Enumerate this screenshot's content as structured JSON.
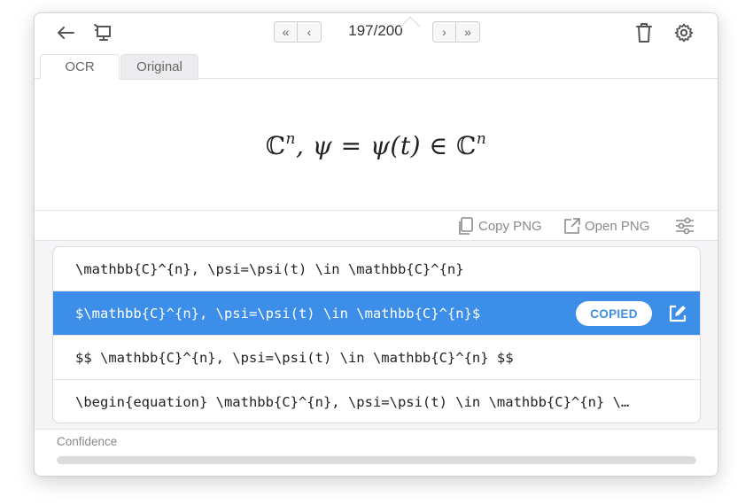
{
  "toolbar": {
    "back_icon": "arrow-left-icon",
    "screen_icon": "screen-capture-icon",
    "first_page_glyph": "«",
    "prev_page_glyph": "‹",
    "next_page_glyph": "›",
    "last_page_glyph": "»",
    "page_counter": "197/200",
    "delete_icon": "trash-icon",
    "settings_icon": "gear-icon"
  },
  "tabs": [
    {
      "label": "OCR",
      "active": true
    },
    {
      "label": "Original",
      "active": false
    }
  ],
  "preview": {
    "formula_latex": "\\mathbb{C}^{n}, \\psi=\\psi(t) \\in \\mathbb{C}^{n}",
    "part_C1": "ℂ",
    "sup_n1": "n",
    "part_mid": ", ψ = ψ(t) ∈",
    "part_C2": "ℂ",
    "sup_n2": "n"
  },
  "actions": {
    "copy_png": "Copy PNG",
    "open_png": "Open PNG",
    "settings_icon": "sliders-icon"
  },
  "results": [
    {
      "text": "\\mathbb{C}^{n}, \\psi=\\psi(t) \\in \\mathbb{C}^{n}",
      "selected": false
    },
    {
      "text": "$\\mathbb{C}^{n}, \\psi=\\psi(t) \\in \\mathbb{C}^{n}$",
      "selected": true,
      "badge": "COPIED"
    },
    {
      "text": "$$ \\mathbb{C}^{n}, \\psi=\\psi(t) \\in \\mathbb{C}^{n} $$",
      "selected": false
    },
    {
      "text": "\\begin{equation} \\mathbb{C}^{n}, \\psi=\\psi(t) \\in \\mathbb{C}^{n} \\…",
      "selected": false
    }
  ],
  "confidence": {
    "label": "Confidence",
    "value": 1.0
  },
  "colors": {
    "accent": "#3d8ee8",
    "selected_text": "#ffffff",
    "muted": "#8a8a8a"
  }
}
